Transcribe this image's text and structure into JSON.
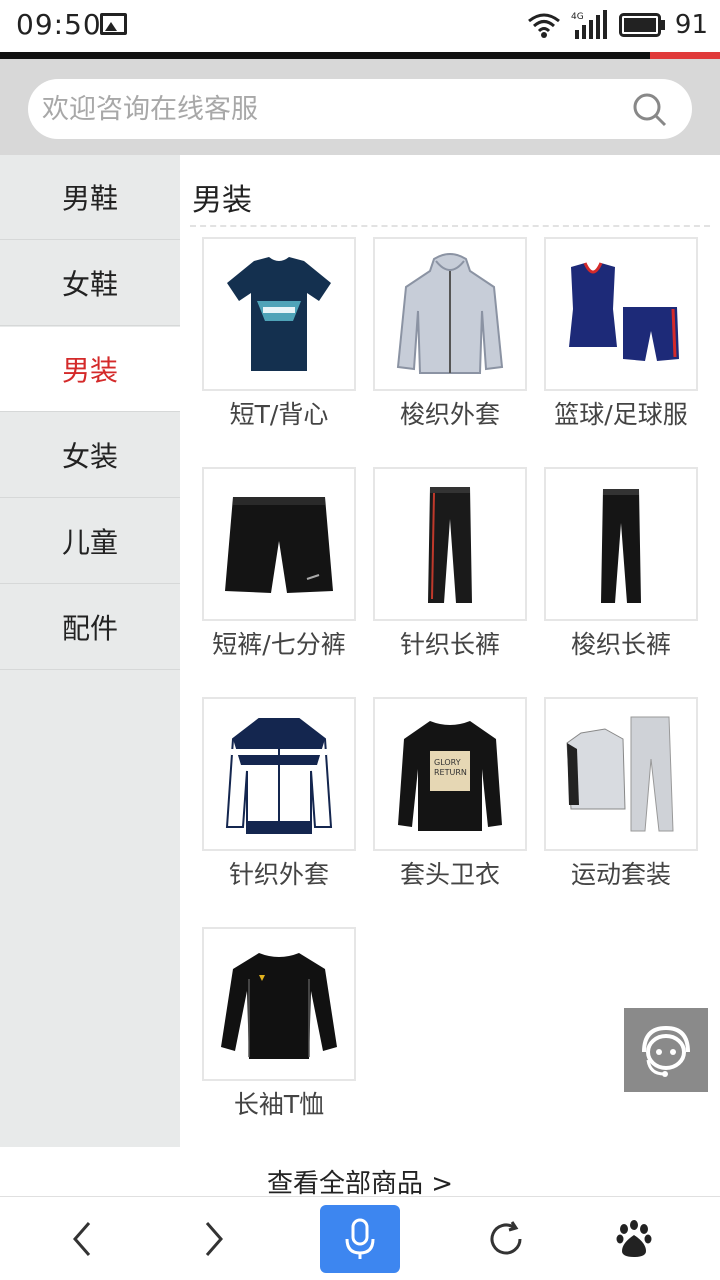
{
  "status_bar": {
    "time": "09:50",
    "battery": "91",
    "icons": [
      "gallery-icon",
      "wifi-icon",
      "signal-4g-icon",
      "battery-icon"
    ]
  },
  "search": {
    "placeholder": "欢迎咨询在线客服"
  },
  "sidebar": {
    "items": [
      {
        "label": "男鞋"
      },
      {
        "label": "女鞋"
      },
      {
        "label": "男装",
        "active": true
      },
      {
        "label": "女装"
      },
      {
        "label": "儿童"
      },
      {
        "label": "配件"
      }
    ]
  },
  "main": {
    "section_title": "男装",
    "products": [
      {
        "label": "短T/背心",
        "icon": "tshirt-icon"
      },
      {
        "label": "梭织外套",
        "icon": "hooded-jacket-icon"
      },
      {
        "label": "篮球/足球服",
        "icon": "basketball-kit-icon"
      },
      {
        "label": "短裤/七分裤",
        "icon": "shorts-icon"
      },
      {
        "label": "针织长裤",
        "icon": "knit-pants-icon"
      },
      {
        "label": "梭织长裤",
        "icon": "woven-pants-icon"
      },
      {
        "label": "针织外套",
        "icon": "track-jacket-icon"
      },
      {
        "label": "套头卫衣",
        "icon": "sweatshirt-icon"
      },
      {
        "label": "运动套装",
        "icon": "tracksuit-icon"
      },
      {
        "label": "长袖T恤",
        "icon": "long-sleeve-tee-icon"
      }
    ],
    "view_all": "查看全部商品 >"
  },
  "colors": {
    "accent_red": "#d42a2a",
    "mic_blue": "#3d86f0",
    "sidebar_bg": "#e8eaea"
  },
  "bottom_nav": [
    "back-icon",
    "forward-icon",
    "mic-icon",
    "refresh-icon",
    "baidu-paw-icon"
  ]
}
